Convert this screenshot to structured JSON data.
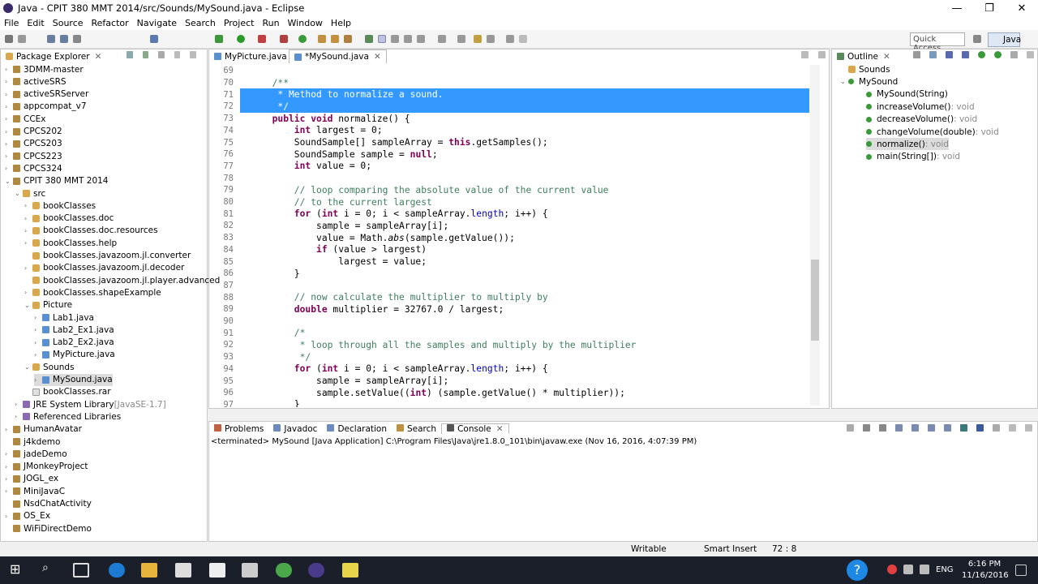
{
  "window": {
    "title": "Java - CPIT 380 MMT 2014/src/Sounds/MySound.java - Eclipse",
    "minimize": "—",
    "maximize": "❐",
    "close": "✕"
  },
  "menu": [
    "File",
    "Edit",
    "Source",
    "Refactor",
    "Navigate",
    "Search",
    "Project",
    "Run",
    "Window",
    "Help"
  ],
  "toolbar": {
    "quick_access": "Quick Access",
    "perspective": "Java"
  },
  "package_explorer": {
    "title": "Package Explorer",
    "items": [
      {
        "label": "3DMM-master",
        "kind": "proj",
        "arrow": "›",
        "indent": 0
      },
      {
        "label": "activeSRS",
        "kind": "proj",
        "arrow": "›",
        "indent": 0
      },
      {
        "label": "activeSRServer",
        "kind": "proj",
        "arrow": "›",
        "indent": 0
      },
      {
        "label": "appcompat_v7",
        "kind": "proj",
        "arrow": "›",
        "indent": 0
      },
      {
        "label": "CCEx",
        "kind": "proj",
        "arrow": "›",
        "indent": 0
      },
      {
        "label": "CPCS202",
        "kind": "proj",
        "arrow": "›",
        "indent": 0
      },
      {
        "label": "CPCS203",
        "kind": "proj",
        "arrow": "›",
        "indent": 0
      },
      {
        "label": "CPCS223",
        "kind": "proj",
        "arrow": "›",
        "indent": 0
      },
      {
        "label": "CPCS324",
        "kind": "proj",
        "arrow": "›",
        "indent": 0
      },
      {
        "label": "CPIT 380 MMT 2014",
        "kind": "proj",
        "arrow": "⌄",
        "indent": 0
      },
      {
        "label": "src",
        "kind": "src",
        "arrow": "⌄",
        "indent": 1
      },
      {
        "label": "bookClasses",
        "kind": "pkg",
        "arrow": "›",
        "indent": 2
      },
      {
        "label": "bookClasses.doc",
        "kind": "pkg",
        "arrow": "›",
        "indent": 2
      },
      {
        "label": "bookClasses.doc.resources",
        "kind": "pkg",
        "arrow": "›",
        "indent": 2
      },
      {
        "label": "bookClasses.help",
        "kind": "pkg",
        "arrow": "›",
        "indent": 2
      },
      {
        "label": "bookClasses.javazoom.jl.converter",
        "kind": "pkg",
        "arrow": "",
        "indent": 2
      },
      {
        "label": "bookClasses.javazoom.jl.decoder",
        "kind": "pkg",
        "arrow": "›",
        "indent": 2
      },
      {
        "label": "bookClasses.javazoom.jl.player.advanced",
        "kind": "pkg",
        "arrow": "",
        "indent": 2
      },
      {
        "label": "bookClasses.shapeExample",
        "kind": "pkg",
        "arrow": "›",
        "indent": 2
      },
      {
        "label": "Picture",
        "kind": "pkg",
        "arrow": "⌄",
        "indent": 2
      },
      {
        "label": "Lab1.java",
        "kind": "java",
        "arrow": "›",
        "indent": 3
      },
      {
        "label": "Lab2_Ex1.java",
        "kind": "java",
        "arrow": "›",
        "indent": 3
      },
      {
        "label": "Lab2_Ex2.java",
        "kind": "java",
        "arrow": "›",
        "indent": 3
      },
      {
        "label": "MyPicture.java",
        "kind": "java",
        "arrow": "›",
        "indent": 3
      },
      {
        "label": "Sounds",
        "kind": "pkg",
        "arrow": "⌄",
        "indent": 2
      },
      {
        "label": "MySound.java",
        "kind": "java",
        "arrow": "›",
        "indent": 3,
        "selected": true
      },
      {
        "label": "bookClasses.rar",
        "kind": "file",
        "arrow": "",
        "indent": 2
      },
      {
        "label": "JRE System Library",
        "suffix": " [JavaSE-1.7]",
        "kind": "jre",
        "arrow": "›",
        "indent": 1
      },
      {
        "label": "Referenced Libraries",
        "kind": "lib",
        "arrow": "›",
        "indent": 1
      },
      {
        "label": "HumanAvatar",
        "kind": "proj",
        "arrow": "›",
        "indent": 0
      },
      {
        "label": "j4kdemo",
        "kind": "proj",
        "arrow": "",
        "indent": 0
      },
      {
        "label": "jadeDemo",
        "kind": "proj",
        "arrow": "›",
        "indent": 0
      },
      {
        "label": "JMonkeyProject",
        "kind": "proj",
        "arrow": "›",
        "indent": 0
      },
      {
        "label": "JOGL_ex",
        "kind": "proj",
        "arrow": "›",
        "indent": 0
      },
      {
        "label": "MiniJavaC",
        "kind": "proj",
        "arrow": "›",
        "indent": 0
      },
      {
        "label": "NsdChatActivity",
        "kind": "proj",
        "arrow": "",
        "indent": 0
      },
      {
        "label": "OS_Ex",
        "kind": "proj",
        "arrow": "›",
        "indent": 0
      },
      {
        "label": "WiFiDirectDemo",
        "kind": "proj",
        "arrow": "",
        "indent": 0
      }
    ]
  },
  "editor": {
    "tabs": [
      {
        "label": "MyPicture.java",
        "active": false
      },
      {
        "label": "*MySound.java",
        "active": true
      }
    ],
    "lines": [
      {
        "n": "69",
        "parts": []
      },
      {
        "n": "70",
        "parts": [
          [
            "cm",
            "  /**"
          ]
        ]
      },
      {
        "n": "71",
        "parts": [
          [
            "cm",
            "   "
          ],
          [
            "sel",
            "* Method to normalize a sound."
          ]
        ],
        "sel": true
      },
      {
        "n": "72",
        "parts": [
          [
            "sel",
            "   */"
          ]
        ],
        "sel": true
      },
      {
        "n": "73",
        "parts": [
          [
            "kw",
            "  public void "
          ],
          [
            "",
            "normalize() {"
          ]
        ]
      },
      {
        "n": "74",
        "parts": [
          [
            "kw",
            "      int "
          ],
          [
            "",
            "largest = 0;"
          ]
        ]
      },
      {
        "n": "75",
        "parts": [
          [
            "",
            "      SoundSample[] sampleArray = "
          ],
          [
            "kw",
            "this"
          ],
          [
            "",
            ".getSamples();"
          ]
        ]
      },
      {
        "n": "76",
        "parts": [
          [
            "",
            "      SoundSample sample = "
          ],
          [
            "kw",
            "null"
          ],
          [
            "",
            ";"
          ]
        ]
      },
      {
        "n": "77",
        "parts": [
          [
            "kw",
            "      int "
          ],
          [
            "",
            "value = 0;"
          ]
        ]
      },
      {
        "n": "78",
        "parts": []
      },
      {
        "n": "79",
        "parts": [
          [
            "cm",
            "      // loop comparing the absolute value of the current value"
          ]
        ]
      },
      {
        "n": "80",
        "parts": [
          [
            "cm",
            "      // to the current largest"
          ]
        ]
      },
      {
        "n": "81",
        "parts": [
          [
            "kw",
            "      for "
          ],
          [
            "",
            "("
          ],
          [
            "kw",
            "int "
          ],
          [
            "",
            "i = 0; i < sampleArray."
          ],
          [
            "fld",
            "length"
          ],
          [
            "",
            "; i++) {"
          ]
        ]
      },
      {
        "n": "82",
        "parts": [
          [
            "",
            "          sample = sampleArray[i];"
          ]
        ]
      },
      {
        "n": "83",
        "parts": [
          [
            "",
            "          value = Math."
          ],
          [
            "it",
            "abs"
          ],
          [
            "",
            "(sample.getValue());"
          ]
        ]
      },
      {
        "n": "84",
        "parts": [
          [
            "kw",
            "          if "
          ],
          [
            "",
            "(value > largest)"
          ]
        ]
      },
      {
        "n": "85",
        "parts": [
          [
            "",
            "              largest = value;"
          ]
        ]
      },
      {
        "n": "86",
        "parts": [
          [
            "",
            "      }"
          ]
        ]
      },
      {
        "n": "87",
        "parts": []
      },
      {
        "n": "88",
        "parts": [
          [
            "cm",
            "      // now calculate the multiplier to multiply by"
          ]
        ]
      },
      {
        "n": "89",
        "parts": [
          [
            "kw",
            "      double "
          ],
          [
            "",
            "multiplier = 32767.0 / largest;"
          ]
        ]
      },
      {
        "n": "90",
        "parts": []
      },
      {
        "n": "91",
        "parts": [
          [
            "cm",
            "      /*"
          ]
        ]
      },
      {
        "n": "92",
        "parts": [
          [
            "cm",
            "       * loop through all the samples and multiply by the multiplier"
          ]
        ]
      },
      {
        "n": "93",
        "parts": [
          [
            "cm",
            "       */"
          ]
        ]
      },
      {
        "n": "94",
        "parts": [
          [
            "kw",
            "      for "
          ],
          [
            "",
            "("
          ],
          [
            "kw",
            "int "
          ],
          [
            "",
            "i = 0; i < sampleArray."
          ],
          [
            "fld",
            "length"
          ],
          [
            "",
            "; i++) {"
          ]
        ]
      },
      {
        "n": "95",
        "parts": [
          [
            "",
            "          sample = sampleArray[i];"
          ]
        ]
      },
      {
        "n": "96",
        "parts": [
          [
            "",
            "          sample.setValue(("
          ],
          [
            "kw",
            "int"
          ],
          [
            "",
            ") (sample.getValue() * multiplier));"
          ]
        ]
      },
      {
        "n": "97",
        "parts": [
          [
            "",
            "      }"
          ]
        ]
      }
    ]
  },
  "outline": {
    "title": "Outline",
    "items": [
      {
        "label": "Sounds",
        "suffix": "",
        "indent": 0,
        "kind": "pkg"
      },
      {
        "label": "MySound",
        "suffix": "",
        "indent": 0,
        "kind": "class"
      },
      {
        "label": "MySound(String)",
        "suffix": "",
        "indent": 2,
        "kind": "m"
      },
      {
        "label": "increaseVolume()",
        "suffix": " : void",
        "indent": 2,
        "kind": "m"
      },
      {
        "label": "decreaseVolume()",
        "suffix": " : void",
        "indent": 2,
        "kind": "m"
      },
      {
        "label": "changeVolume(double)",
        "suffix": " : void",
        "indent": 2,
        "kind": "m"
      },
      {
        "label": "normalize()",
        "suffix": " : void",
        "indent": 2,
        "kind": "m",
        "selected": true
      },
      {
        "label": "main(String[])",
        "suffix": " : void",
        "indent": 2,
        "kind": "m"
      }
    ]
  },
  "bottom": {
    "tabs": [
      "Problems",
      "Javadoc",
      "Declaration",
      "Search",
      "Console"
    ],
    "console_line": "<terminated> MySound [Java Application] C:\\Program Files\\Java\\jre1.8.0_101\\bin\\javaw.exe (Nov 16, 2016, 4:07:39 PM)"
  },
  "status": {
    "writable": "Writable",
    "insert": "Smart Insert",
    "position": "72 : 8"
  },
  "taskbar": {
    "time": "6:16 PM",
    "date": "11/16/2016",
    "lang": "ENG"
  }
}
